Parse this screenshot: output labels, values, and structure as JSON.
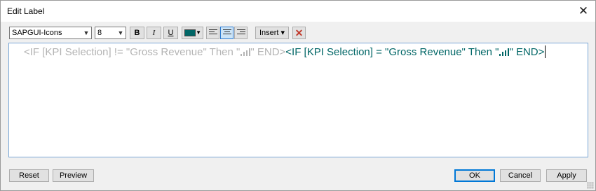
{
  "window": {
    "title": "Edit Label",
    "close_glyph": "✕"
  },
  "toolbar": {
    "font_family": "SAPGUI-Icons",
    "font_size": "8",
    "bold_label": "B",
    "italic_label": "I",
    "underline_label": "U",
    "text_color": "#006666",
    "align_active": "center",
    "insert_label": "Insert ▾",
    "clear_glyph": "✕"
  },
  "editor": {
    "ghost_text_before": "<IF [KPI Selection] != \"Gross Revenue\" Then \"",
    "ghost_text_after": "\"  END>",
    "live_text_before": "<IF [KPI Selection] = \"Gross Revenue\" Then \"",
    "live_text_after": "\"  END>",
    "glyph_icon": "bar-chart-icon"
  },
  "footer": {
    "reset_label": "Reset",
    "preview_label": "Preview",
    "ok_label": "OK",
    "cancel_label": "Cancel",
    "apply_label": "Apply"
  }
}
